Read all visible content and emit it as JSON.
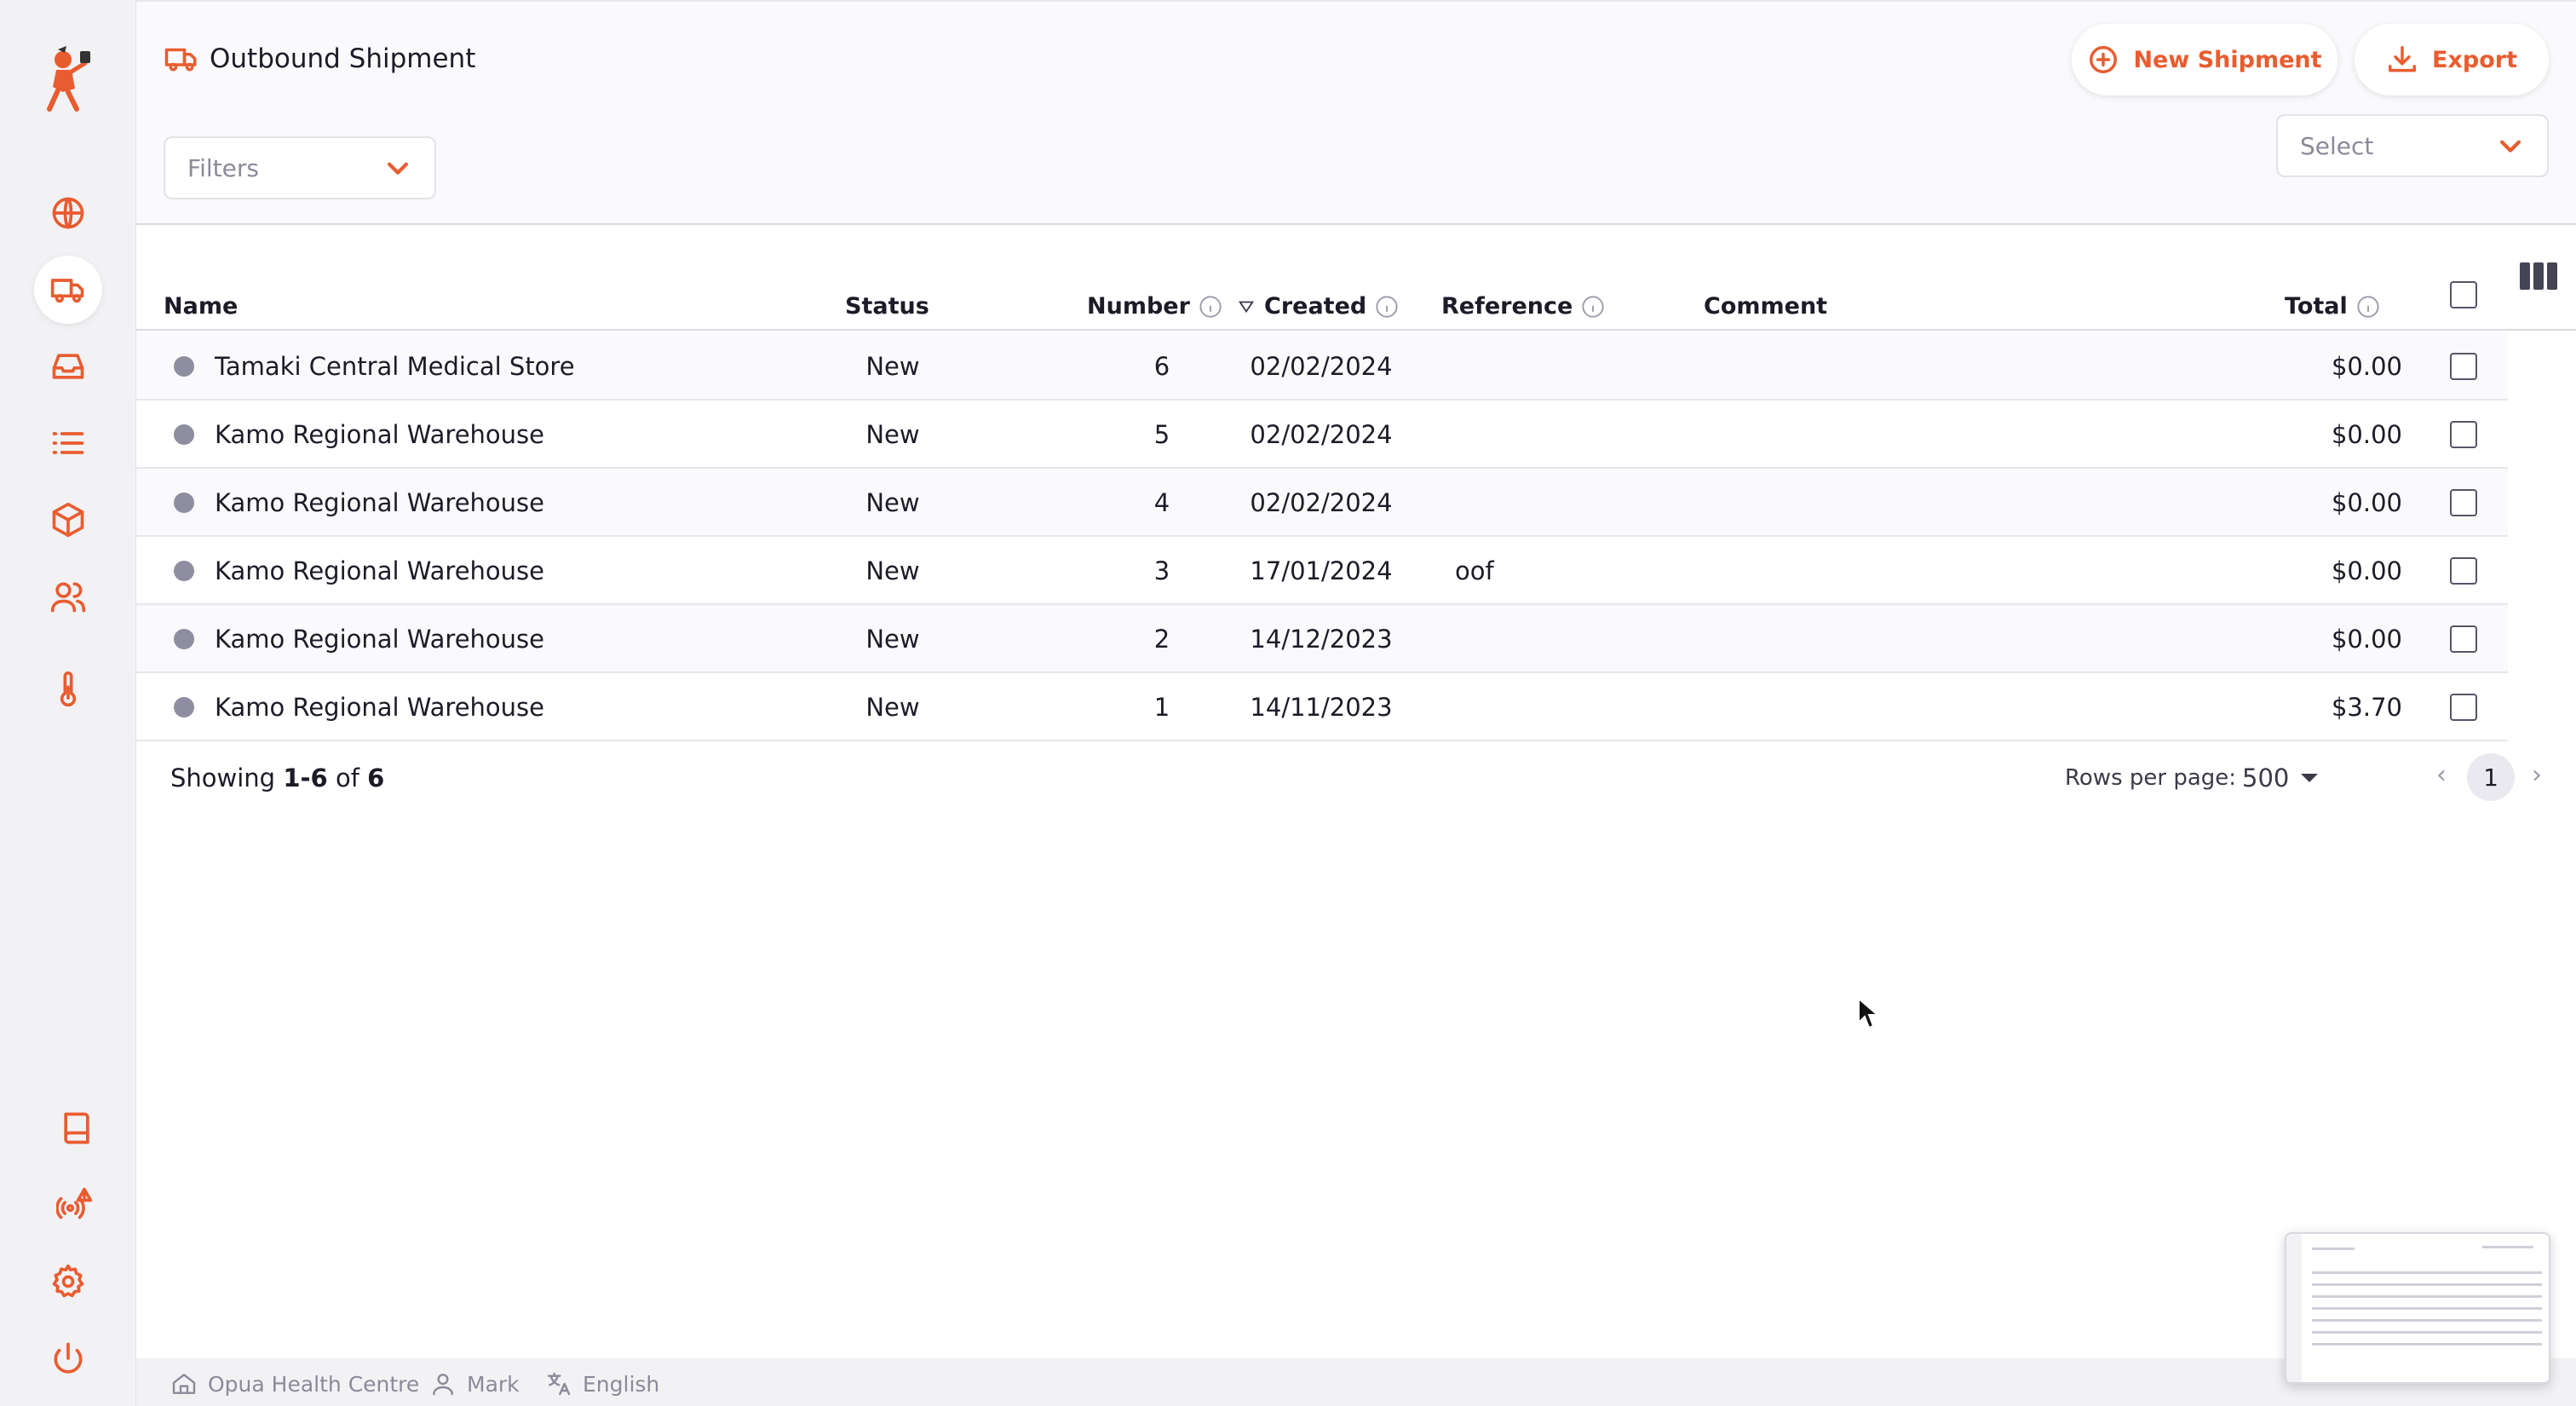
{
  "app": {
    "page_title": "Outbound Shipment",
    "accent_color": "#e95c30"
  },
  "sidebar": {
    "items": [
      {
        "name": "globe-icon"
      },
      {
        "name": "truck-icon",
        "active": true
      },
      {
        "name": "inbox-icon"
      },
      {
        "name": "list-icon"
      },
      {
        "name": "box-icon"
      },
      {
        "name": "users-icon"
      },
      {
        "name": "thermometer-icon"
      }
    ],
    "bottom_items": [
      {
        "name": "book-icon"
      },
      {
        "name": "signal-alert-icon"
      },
      {
        "name": "gear-icon"
      },
      {
        "name": "power-icon"
      }
    ]
  },
  "toolbar": {
    "new_shipment_label": "New Shipment",
    "export_label": "Export",
    "filters_placeholder": "Filters",
    "select_placeholder": "Select"
  },
  "table": {
    "columns": {
      "name": "Name",
      "status": "Status",
      "number": "Number",
      "created": "Created",
      "reference": "Reference",
      "comment": "Comment",
      "total": "Total"
    },
    "rows": [
      {
        "name": "Tamaki Central Medical Store",
        "status": "New",
        "number": "6",
        "created": "02/02/2024",
        "reference": "",
        "comment": "",
        "total": "$0.00"
      },
      {
        "name": "Kamo Regional Warehouse",
        "status": "New",
        "number": "5",
        "created": "02/02/2024",
        "reference": "",
        "comment": "",
        "total": "$0.00"
      },
      {
        "name": "Kamo Regional Warehouse",
        "status": "New",
        "number": "4",
        "created": "02/02/2024",
        "reference": "",
        "comment": "",
        "total": "$0.00"
      },
      {
        "name": "Kamo Regional Warehouse",
        "status": "New",
        "number": "3",
        "created": "17/01/2024",
        "reference": "oof",
        "comment": "",
        "total": "$0.00"
      },
      {
        "name": "Kamo Regional Warehouse",
        "status": "New",
        "number": "2",
        "created": "14/12/2023",
        "reference": "",
        "comment": "",
        "total": "$0.00"
      },
      {
        "name": "Kamo Regional Warehouse",
        "status": "New",
        "number": "1",
        "created": "14/11/2023",
        "reference": "",
        "comment": "",
        "total": "$3.70"
      }
    ]
  },
  "pagination": {
    "showing_prefix": "Showing",
    "showing_range": "1-6",
    "showing_of": "of",
    "showing_total": "6",
    "rows_per_page_label": "Rows per page:",
    "rows_per_page_value": "500",
    "current_page": "1"
  },
  "statusbar": {
    "store": "Opua Health Centre",
    "user": "Mark",
    "language": "English"
  }
}
